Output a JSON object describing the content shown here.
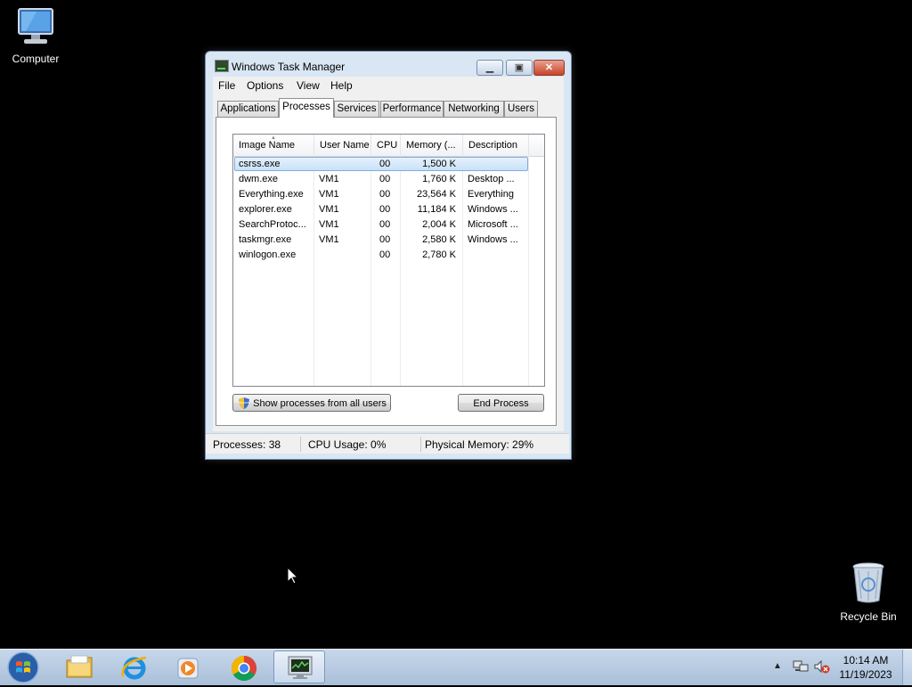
{
  "desktop": {
    "icons": [
      {
        "label": "Computer"
      },
      {
        "label": "Recycle Bin"
      }
    ]
  },
  "window": {
    "title": "Windows Task Manager",
    "menu": [
      "File",
      "Options",
      "View",
      "Help"
    ],
    "tabs": [
      "Applications",
      "Processes",
      "Services",
      "Performance",
      "Networking",
      "Users"
    ],
    "active_tab": "Processes",
    "columns": [
      "Image Name",
      "User Name",
      "CPU",
      "Memory (...",
      "Description"
    ],
    "rows": [
      {
        "name": "csrss.exe",
        "user": "",
        "cpu": "00",
        "mem": "1,500 K",
        "desc": ""
      },
      {
        "name": "dwm.exe",
        "user": "VM1",
        "cpu": "00",
        "mem": "1,760 K",
        "desc": "Desktop ..."
      },
      {
        "name": "Everything.exe",
        "user": "VM1",
        "cpu": "00",
        "mem": "23,564 K",
        "desc": "Everything"
      },
      {
        "name": "explorer.exe",
        "user": "VM1",
        "cpu": "00",
        "mem": "11,184 K",
        "desc": "Windows ..."
      },
      {
        "name": "SearchProtoc...",
        "user": "VM1",
        "cpu": "00",
        "mem": "2,004 K",
        "desc": "Microsoft ..."
      },
      {
        "name": "taskmgr.exe",
        "user": "VM1",
        "cpu": "00",
        "mem": "2,580 K",
        "desc": "Windows ..."
      },
      {
        "name": "winlogon.exe",
        "user": "",
        "cpu": "00",
        "mem": "2,780 K",
        "desc": ""
      }
    ],
    "buttons": {
      "show_all": "Show processes from all users",
      "end_process": "End Process"
    },
    "status": {
      "processes": "Processes: 38",
      "cpu": "CPU Usage: 0%",
      "memory": "Physical Memory: 29%"
    }
  },
  "taskbar": {
    "pinned": [
      "folder-icon",
      "internet-explorer-icon",
      "media-player-icon",
      "chrome-icon",
      "task-manager-icon"
    ],
    "clock": {
      "time": "10:14 AM",
      "date": "11/19/2023"
    }
  }
}
